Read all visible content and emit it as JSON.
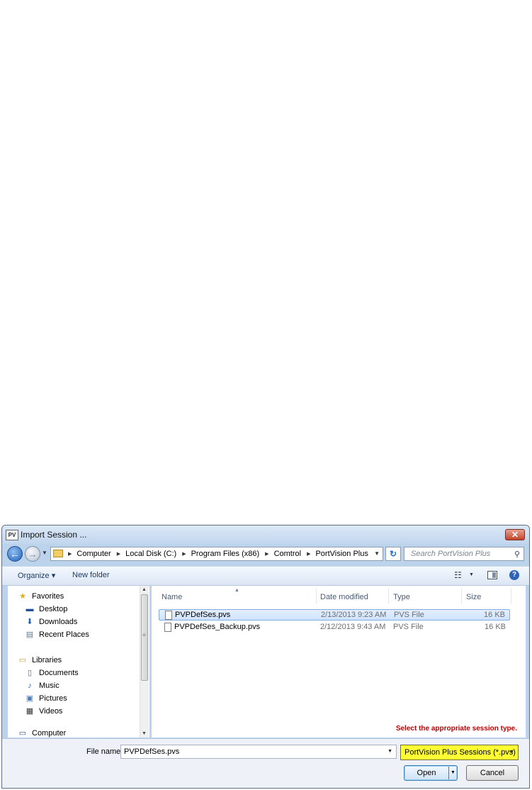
{
  "document": {
    "link_top": "",
    "link_mid": ""
  },
  "dialog": {
    "app_icon": "PV",
    "title": "Import Session ...",
    "close": "✕"
  },
  "address": {
    "crumbs": [
      "Computer",
      "Local Disk (C:)",
      "Program Files (x86)",
      "Comtrol",
      "PortVision Plus"
    ],
    "search_placeholder": "Search PortVision Plus"
  },
  "toolbar": {
    "organize": "Organize ▾",
    "new_folder": "New folder"
  },
  "nav": {
    "items": [
      {
        "label": "Favorites",
        "icon": "star-icon"
      },
      {
        "label": "Desktop",
        "icon": "desktop-icon"
      },
      {
        "label": "Downloads",
        "icon": "downloads-icon"
      },
      {
        "label": "Recent Places",
        "icon": "recent-places-icon"
      },
      {
        "label": "Libraries",
        "icon": "libraries-icon"
      },
      {
        "label": "Documents",
        "icon": "documents-icon"
      },
      {
        "label": "Music",
        "icon": "music-icon"
      },
      {
        "label": "Pictures",
        "icon": "pictures-icon"
      },
      {
        "label": "Videos",
        "icon": "videos-icon"
      },
      {
        "label": "Computer",
        "icon": "computer-icon"
      }
    ]
  },
  "files": {
    "columns": [
      "Name",
      "Date modified",
      "Type",
      "Size"
    ],
    "rows": [
      {
        "name": "PVPDefSes.pvs",
        "date": "2/13/2013 9:23 AM",
        "type": "PVS File",
        "size": "16 KB",
        "selected": true
      },
      {
        "name": "PVPDefSes_Backup.pvs",
        "date": "2/12/2013 9:43 AM",
        "type": "PVS File",
        "size": "16 KB",
        "selected": false
      }
    ],
    "note": "Select the appropriate session type."
  },
  "bottom": {
    "file_name_label": "File name:",
    "file_name_value": "PVPDefSes.pvs",
    "filter": "PortVision Plus Sessions (*.pvs)",
    "open": "Open",
    "cancel": "Cancel"
  }
}
